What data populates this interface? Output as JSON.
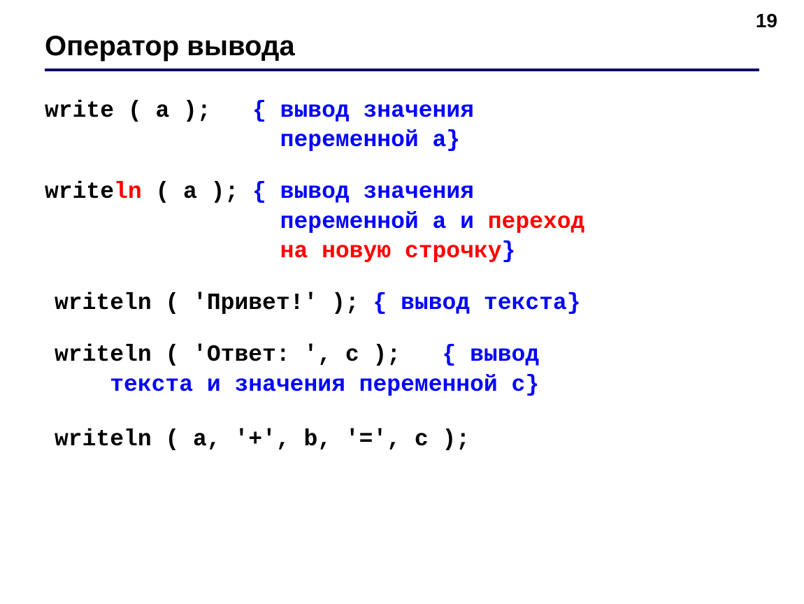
{
  "page_number": "19",
  "title": "Оператор вывода",
  "blocks": {
    "b1": {
      "line1": {
        "pre": "write",
        "mid": " ( a );   ",
        "c1": "{ вывод значения"
      },
      "line2": {
        "indent": "                 ",
        "c2": "переменной a}"
      }
    },
    "b2": {
      "line1": {
        "pre": "write",
        "ln": "ln",
        "mid": " ( a ); ",
        "c1": "{ вывод значения"
      },
      "line2": {
        "indent": "                 ",
        "c2a": "переменной a и ",
        "c2r": "переход"
      },
      "line3": {
        "indent": "                 ",
        "c3r": "на новую строчку",
        "c3b": "}"
      }
    },
    "b3": {
      "line1": {
        "call": "writeln ( 'Привет!' ); ",
        "cmt": "{ вывод текста}"
      }
    },
    "b4": {
      "line1": {
        "call": "writeln ( 'Ответ: ', c );   ",
        "cmt1": "{ вывод"
      },
      "line2": {
        "indent": "    ",
        "cmt2": "текста и значения переменной c}"
      }
    },
    "b5": {
      "line1": "writeln ( a, '+', b, '=', c );"
    }
  }
}
